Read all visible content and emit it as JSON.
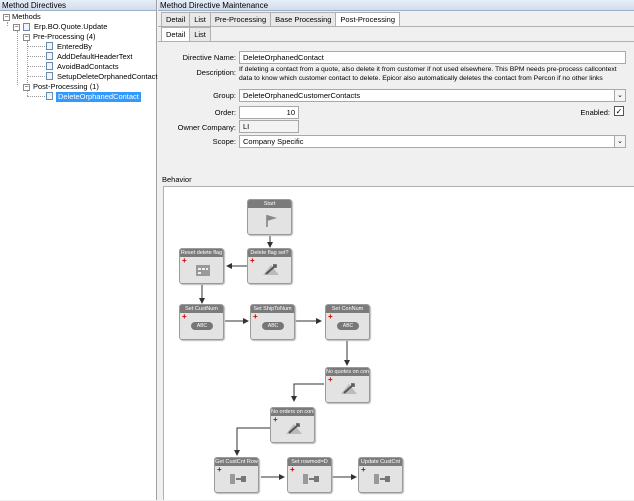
{
  "left_pane": {
    "title": "Method Directives",
    "tree": {
      "root": "Methods",
      "method": "Erp.BO.Quote.Update",
      "pre_processing": "Pre-Processing (4)",
      "pre_items": [
        "EnteredBy",
        "AddDefaultHeaderText",
        "AvoidBadContacts",
        "SetupDeleteOrphanedContact"
      ],
      "post_processing": "Post-Processing (1)",
      "post_items": [
        "DeleteOrphanedContact"
      ]
    }
  },
  "right_pane": {
    "title": "Method Directive Maintenance",
    "top_tabs": [
      "Detail",
      "List",
      "Pre-Processing",
      "Base Processing",
      "Post-Processing"
    ],
    "sub_tabs": [
      "Detail",
      "List"
    ],
    "form": {
      "directive_name_label": "Directive Name:",
      "directive_name": "DeleteOrphanedContact",
      "description_label": "Description:",
      "description_line1": "If deleting a contact from a quote, also delete it from customer if not used elsewhere.  This BPM needs pre-process callcontext",
      "description_line2": "data to know which customer contact to delete. Epicor also automatically deletes the contact from Percon if no other links",
      "group_label": "Group:",
      "group": "DeleteOrphanedCustomerContacts",
      "order_label": "Order:",
      "order": "10",
      "enabled_label": "Enabled:",
      "enabled_check": "✓",
      "owner_label": "Owner Company:",
      "owner": "LI",
      "scope_label": "Scope:",
      "scope": "Company Specific",
      "dropdown_arrow": "⌄"
    },
    "behavior_label": "Behavior"
  },
  "workflow": {
    "nodes": [
      {
        "title": "Start",
        "icon": "flag-icon"
      },
      {
        "title": "Delete flag set?",
        "icon": "condition-icon"
      },
      {
        "title": "Reset delete flag",
        "icon": "calendar-icon"
      },
      {
        "title": "Set CustNum",
        "icon": "abc-icon"
      },
      {
        "title": "Set ShipToNum",
        "icon": "abc-icon"
      },
      {
        "title": "Set ConNum",
        "icon": "abc-icon"
      },
      {
        "title": "No quotes on con!",
        "icon": "condition-icon"
      },
      {
        "title": "No orders on con!",
        "icon": "condition-icon"
      },
      {
        "title": "Get CustCnt Row",
        "icon": "query-icon"
      },
      {
        "title": "Set rowmod=D",
        "icon": "query-icon"
      },
      {
        "title": "Update CustCnt",
        "icon": "query-icon"
      }
    ],
    "abc_text": "ABC",
    "plus": "+"
  }
}
